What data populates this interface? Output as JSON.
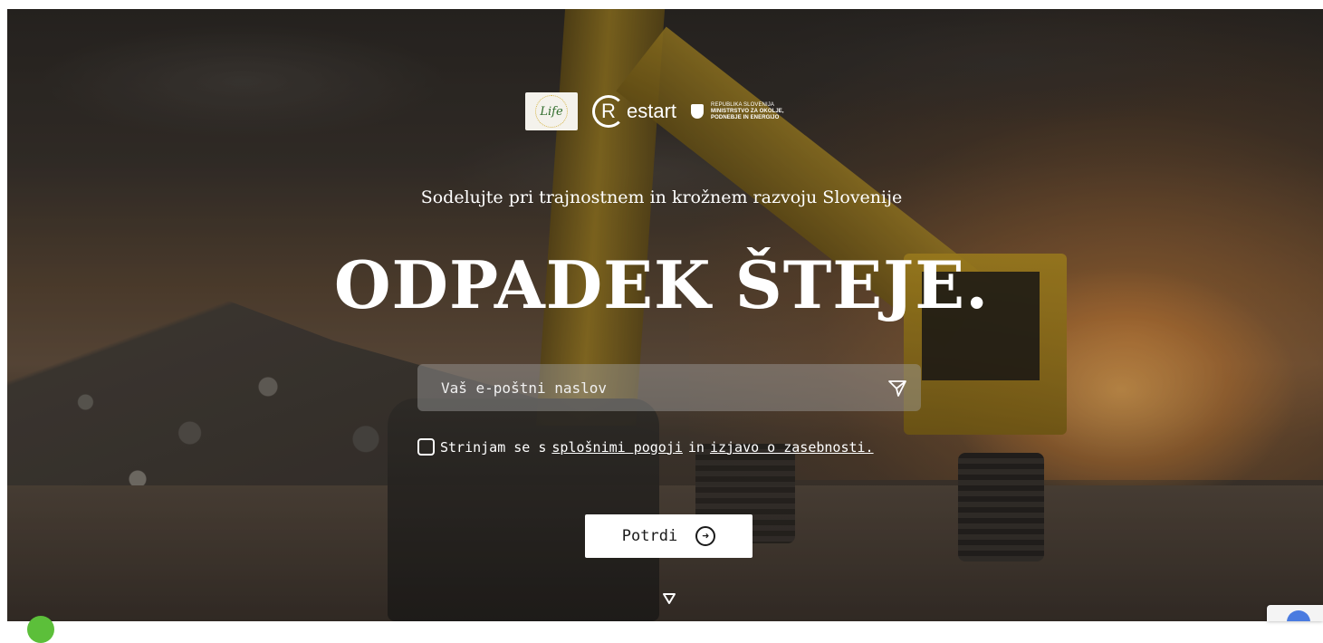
{
  "logos": {
    "life": "Life",
    "restart": "Restart",
    "restart_initial": "R",
    "restart_rest": "estart",
    "ministry_line1": "REPUBLIKA SLOVENIJA",
    "ministry_line2": "MINISTRSTVO ZA OKOLJE,",
    "ministry_line3": "PODNEBJE IN ENERGIJO"
  },
  "hero": {
    "tagline": "Sodelujte pri trajnostnem in krožnem razvoju Slovenije",
    "headline": "ODPADEK ŠTEJE."
  },
  "form": {
    "email_placeholder": "Vaš e-poštni naslov",
    "email_value": "",
    "consent_prefix": "Strinjam se s ",
    "terms_link": "splošnimi pogoji",
    "consent_middle": " in ",
    "privacy_link": "izjavo o zasebnosti.",
    "submit_label": "Potrdi"
  },
  "icons": {
    "send": "send-icon",
    "submit_arrow": "arrow-right-circle-icon",
    "scroll": "triangle-down-icon"
  },
  "colors": {
    "text": "#ffffff",
    "button_bg": "#ffffff",
    "button_text": "#1a1a1a"
  }
}
